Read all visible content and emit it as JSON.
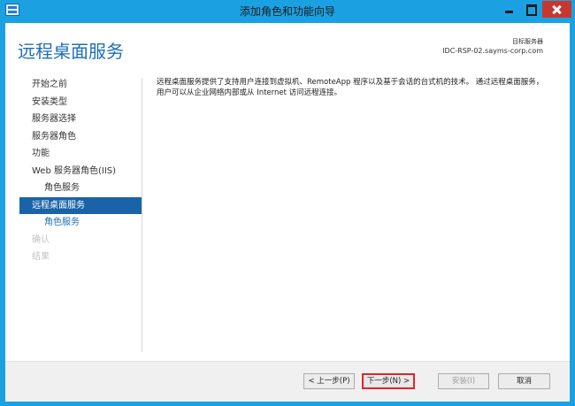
{
  "window": {
    "title": "添加角色和功能向导"
  },
  "header": {
    "page_title": "远程桌面服务",
    "target_label": "目标服务器",
    "target_server": "IDC-RSP-02.sayms-corp.com"
  },
  "nav": {
    "items": [
      {
        "label": "开始之前",
        "state": "normal"
      },
      {
        "label": "安装类型",
        "state": "normal"
      },
      {
        "label": "服务器选择",
        "state": "normal"
      },
      {
        "label": "服务器角色",
        "state": "normal"
      },
      {
        "label": "功能",
        "state": "normal"
      },
      {
        "label": "Web 服务器角色(IIS)",
        "state": "normal"
      },
      {
        "label": "角色服务",
        "state": "sub"
      },
      {
        "label": "远程桌面服务",
        "state": "active"
      },
      {
        "label": "角色服务",
        "state": "sub-link"
      },
      {
        "label": "确认",
        "state": "disabled"
      },
      {
        "label": "结果",
        "state": "disabled"
      }
    ]
  },
  "content": {
    "description": "远程桌面服务提供了支持用户连接到虚拟机、RemoteApp 程序以及基于会话的台式机的技术。 通过远程桌面服务，用户可以从企业网络内部或从 Internet 访问远程连接。"
  },
  "footer": {
    "prev_label": "< 上一步(P)",
    "next_label": "下一步(N) >",
    "install_label": "安装(I)",
    "cancel_label": "取消"
  },
  "colors": {
    "frame": "#1ba1e2",
    "accent": "#1c6eb8",
    "active_nav": "#1b63a8",
    "highlight_border": "#e0242a"
  }
}
